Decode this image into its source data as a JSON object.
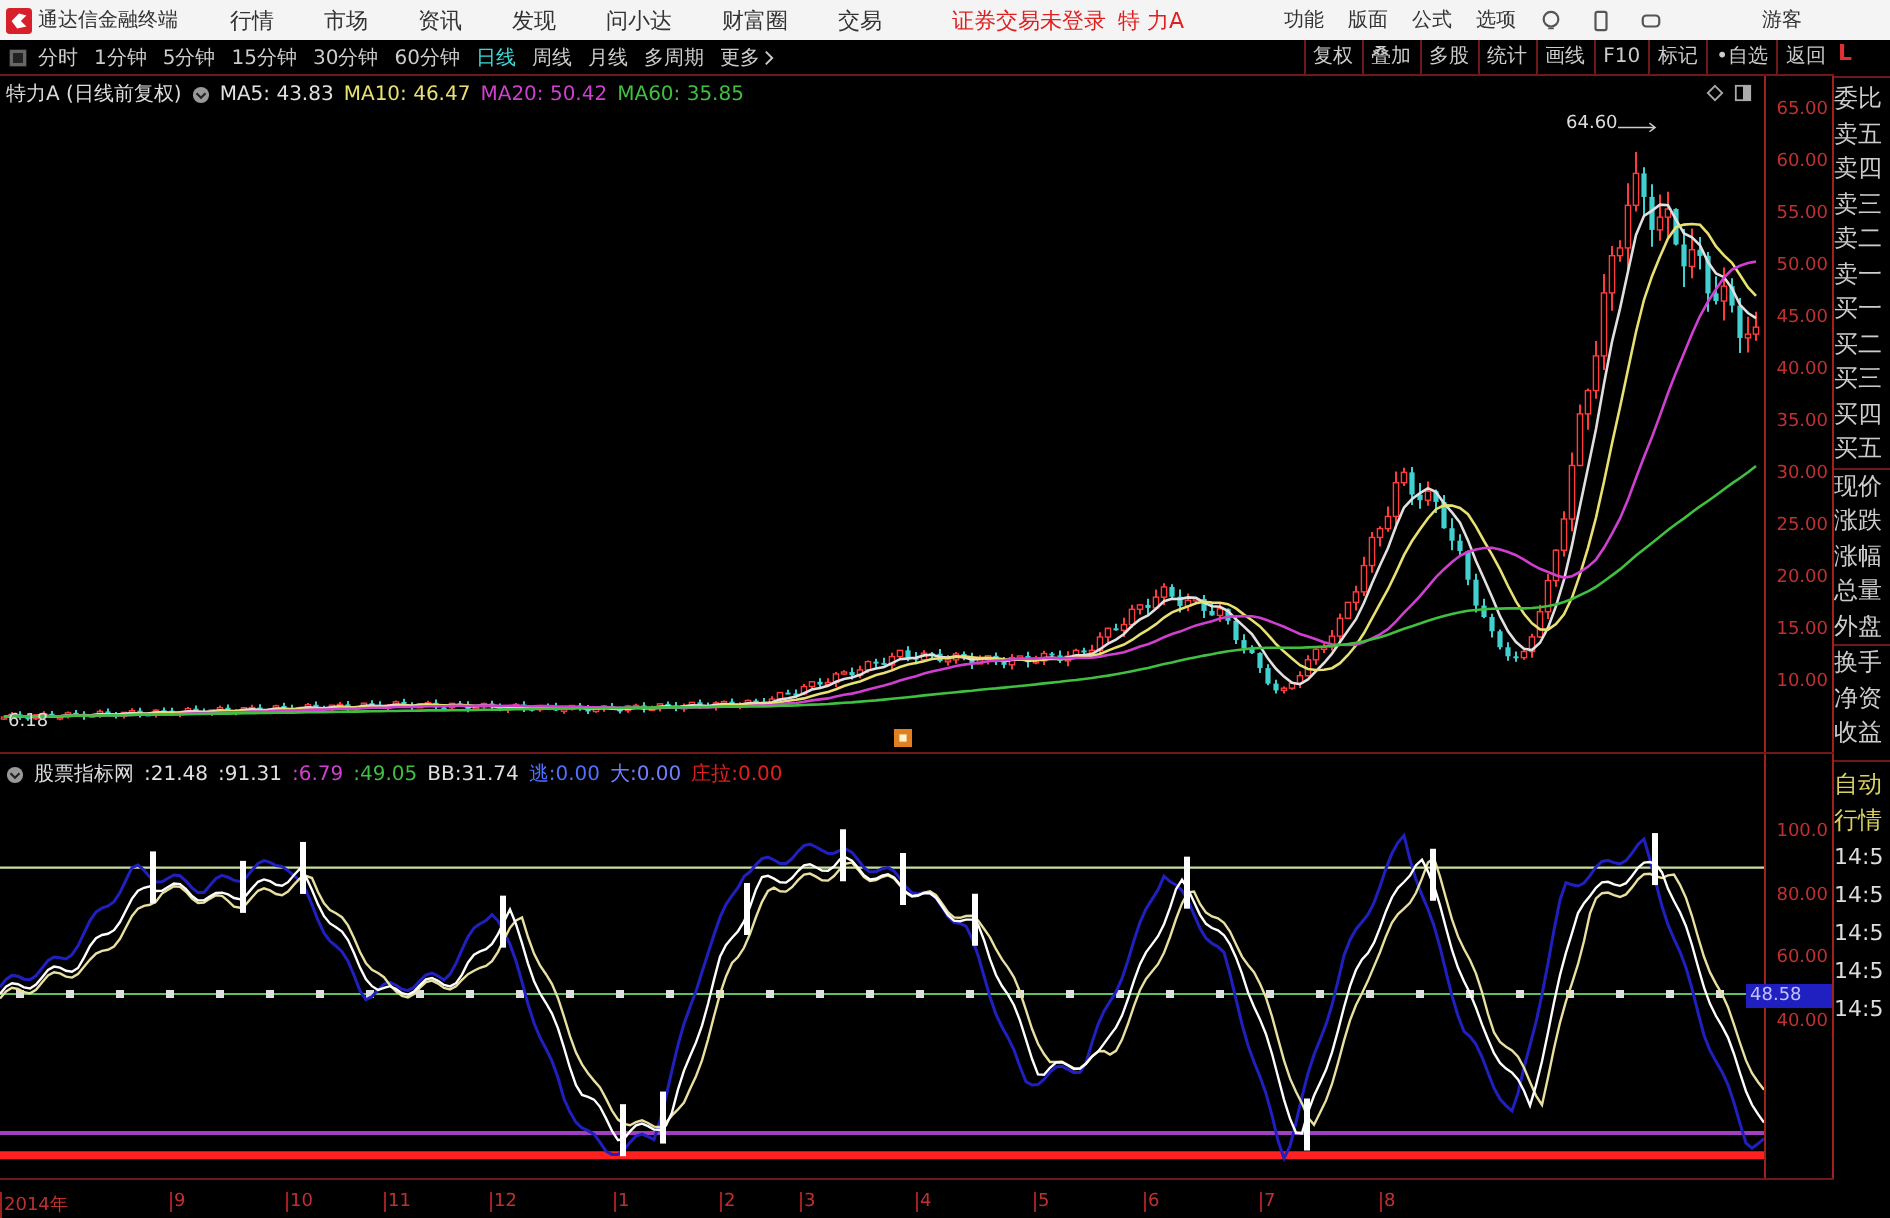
{
  "menu_bar": {
    "app_title": "通达信金融终端",
    "menus": [
      "行情",
      "市场",
      "资讯",
      "发现",
      "问小达",
      "财富圈",
      "交易"
    ],
    "notice": "证券交易未登录",
    "stock": "特 力A",
    "tools": [
      "功能",
      "版面",
      "公式",
      "选项"
    ],
    "user": "游客"
  },
  "period_bar": {
    "periods": [
      {
        "label": "分时",
        "selected": false
      },
      {
        "label": "1分钟",
        "selected": false
      },
      {
        "label": "5分钟",
        "selected": false
      },
      {
        "label": "15分钟",
        "selected": false
      },
      {
        "label": "30分钟",
        "selected": false
      },
      {
        "label": "60分钟",
        "selected": false
      },
      {
        "label": "日线",
        "selected": true
      },
      {
        "label": "周线",
        "selected": false
      },
      {
        "label": "月线",
        "selected": false
      },
      {
        "label": "多周期",
        "selected": false
      },
      {
        "label": "更多",
        "selected": false
      }
    ],
    "actions": [
      "复权",
      "叠加",
      "多股",
      "统计",
      "画线",
      "F10",
      "标记",
      "•自选",
      "返回"
    ]
  },
  "price_chart": {
    "title": "特力A (日线前复权)",
    "ma": [
      {
        "label": "MA5: 43.83",
        "color": "#e0e0e0"
      },
      {
        "label": "MA10: 46.47",
        "color": "#e8e070"
      },
      {
        "label": "MA20: 50.42",
        "color": "#d040d0"
      },
      {
        "label": "MA60: 35.85",
        "color": "#40c040"
      }
    ],
    "high_label": "64.60",
    "low_label": "6.18",
    "yticks": [
      "65.00",
      "60.00",
      "55.00",
      "50.00",
      "45.00",
      "40.00",
      "35.00",
      "30.00",
      "25.00",
      "20.00",
      "15.00",
      "10.00"
    ]
  },
  "indicator": {
    "name": "股票指标网",
    "values": [
      {
        "text": ":21.48",
        "color": "#e0e0e0"
      },
      {
        "text": ":91.31",
        "color": "#e0e0e0"
      },
      {
        "text": ":6.79",
        "color": "#d040d0"
      },
      {
        "text": ":49.05",
        "color": "#40c040"
      },
      {
        "text": "BB:31.74",
        "color": "#e0e0e0"
      },
      {
        "text": "逃:0.00",
        "color": "#5070ff"
      },
      {
        "text": "大:0.00",
        "color": "#7080ff"
      },
      {
        "text": "庄拉:0.00",
        "color": "#e02020"
      }
    ],
    "yticks": [
      "100.0",
      "80.00",
      "60.00",
      "40.00"
    ],
    "current": "48.58"
  },
  "date_axis": [
    "2014年",
    "9",
    "10",
    "11",
    "12",
    "1",
    "2",
    "3",
    "4",
    "5",
    "6",
    "7",
    "8"
  ],
  "side_panel": {
    "corner": "L",
    "quote_labels": [
      "委比",
      "卖五",
      "卖四",
      "卖三",
      "卖二",
      "卖一",
      "买一",
      "买二",
      "买三",
      "买四",
      "买五",
      "现价",
      "涨跌",
      "涨幅",
      "总量",
      "外盘",
      "换手",
      "净资",
      "收益"
    ],
    "auto_labels": [
      "自动",
      "行情"
    ],
    "times": [
      "14:5",
      "14:5",
      "14:5",
      "14:5",
      "14:5"
    ]
  }
}
